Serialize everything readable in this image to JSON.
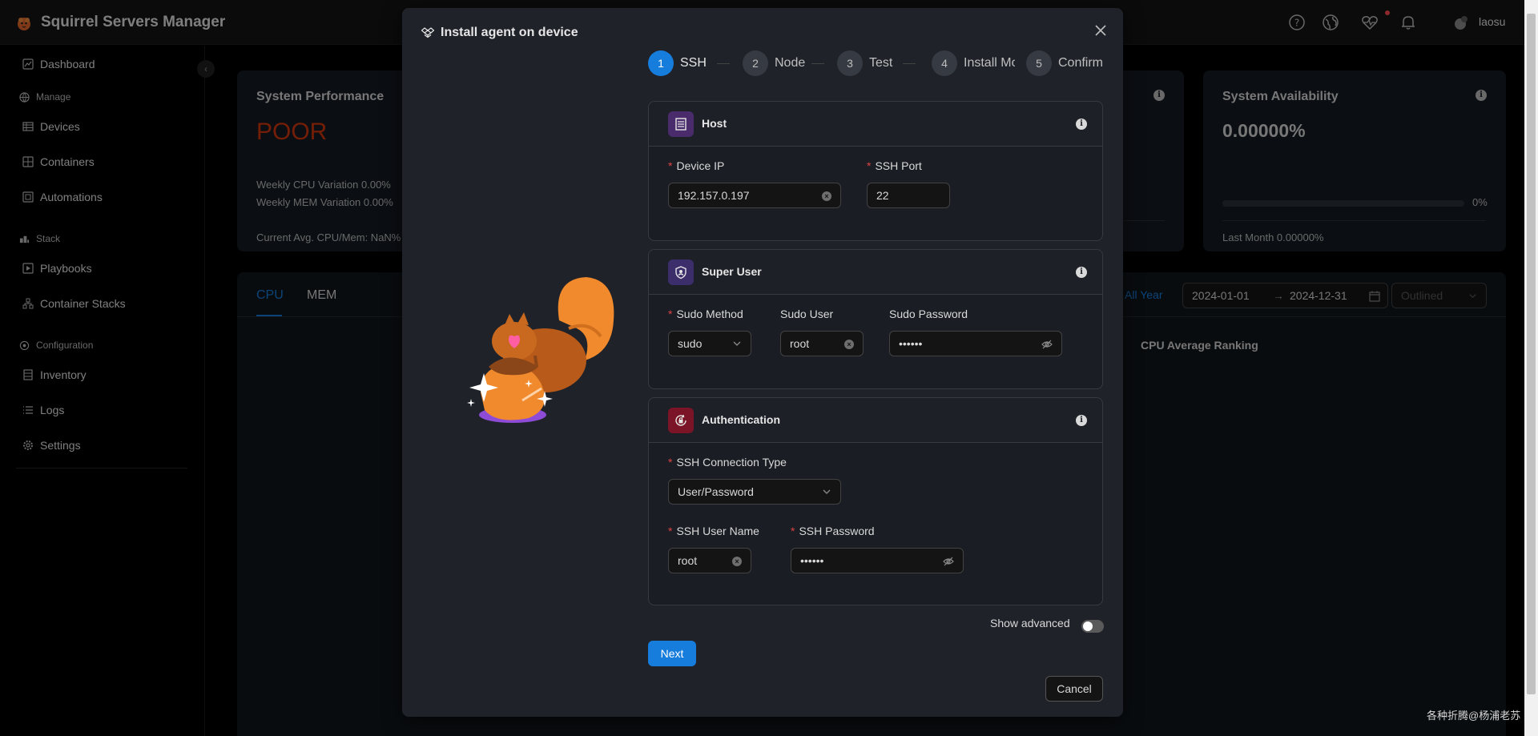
{
  "header": {
    "title": "Squirrel Servers Manager",
    "username": "laosu",
    "icons": [
      "help-icon",
      "globe-icon",
      "heartbeat-icon",
      "bell-icon",
      "avatar"
    ]
  },
  "sidebar": {
    "dashboard": "Dashboard",
    "group_manage": "Manage",
    "devices": "Devices",
    "containers": "Containers",
    "automations": "Automations",
    "group_stack": "Stack",
    "playbooks": "Playbooks",
    "container_stacks": "Container Stacks",
    "group_configuration": "Configuration",
    "inventory": "Inventory",
    "logs": "Logs",
    "settings": "Settings"
  },
  "dashboard": {
    "performance_title": "System Performance",
    "performance_value": "POOR",
    "weekly_cpu": "Weekly CPU Variation  0.00%",
    "weekly_mem": "Weekly MEM Variation  0.00%",
    "current_avg": "Current Avg. CPU/Mem: NaN%",
    "availability_title": "System Availability",
    "availability_value": "0.00000%",
    "availability_pct": "0%",
    "availability_progress": 0,
    "last_month": "Last Month  0.00000%",
    "tab_cpu": "CPU",
    "tab_mem": "MEM",
    "all_year": "All Year",
    "date_start": "2024-01-01",
    "date_end": "2024-12-31",
    "style_select": "Outlined",
    "ranking_title": "CPU Average Ranking"
  },
  "modal": {
    "title": "Install agent on device",
    "steps": [
      {
        "num": "1",
        "label": "SSH"
      },
      {
        "num": "2",
        "label": "Node"
      },
      {
        "num": "3",
        "label": "Test"
      },
      {
        "num": "4",
        "label": "Install Mo"
      },
      {
        "num": "5",
        "label": "Confirm"
      }
    ],
    "host": {
      "title": "Host",
      "device_ip_label": "Device IP",
      "device_ip_value": "192.157.0.197",
      "ssh_port_label": "SSH Port",
      "ssh_port_value": "22"
    },
    "super_user": {
      "title": "Super User",
      "sudo_method_label": "Sudo Method",
      "sudo_method_value": "sudo",
      "sudo_user_label": "Sudo User",
      "sudo_user_value": "root",
      "sudo_password_label": "Sudo Password",
      "sudo_password_value": "••••••"
    },
    "authentication": {
      "title": "Authentication",
      "conn_type_label": "SSH Connection Type",
      "conn_type_value": "User/Password",
      "user_name_label": "SSH User Name",
      "user_name_value": "root",
      "password_label": "SSH Password",
      "password_value": "••••••"
    },
    "show_advanced": "Show advanced",
    "next": "Next",
    "cancel": "Cancel"
  },
  "watermark": "各种折腾@杨浦老苏",
  "colors": {
    "primary": "#177ddc",
    "danger": "#d4380d",
    "host_icon_bg": "#4a2b6b",
    "auth_icon_bg": "#7a1426"
  }
}
